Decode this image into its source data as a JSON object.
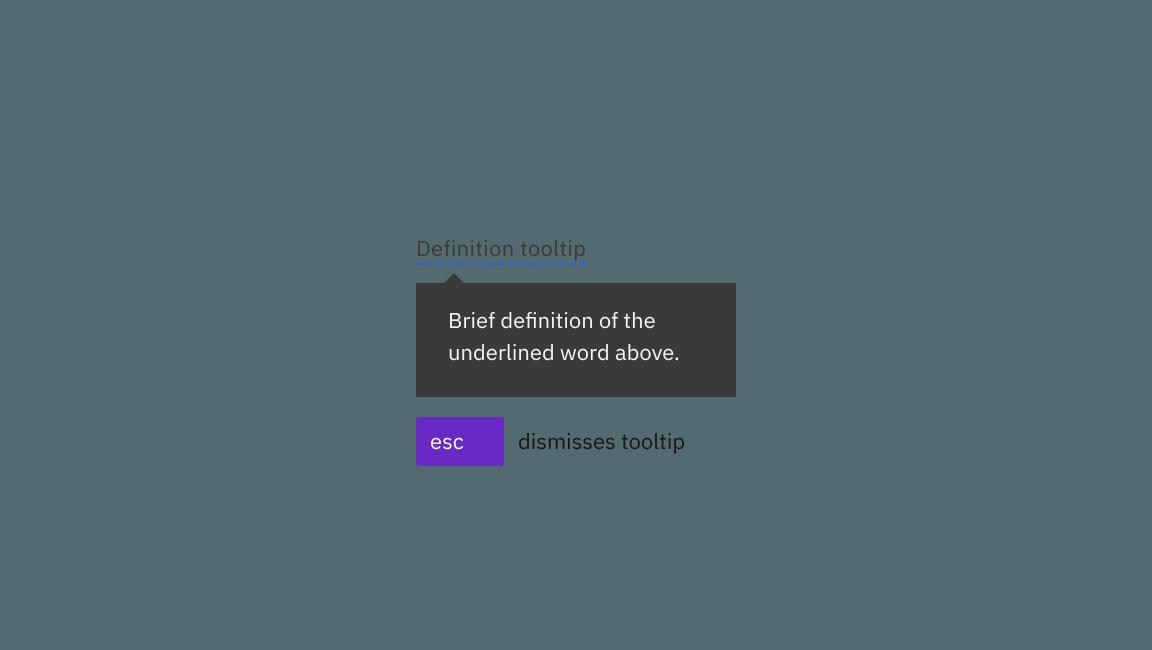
{
  "trigger_label": "Definition tooltip",
  "tooltip_body": "Brief definition of the underlined word above.",
  "key_label": "esc",
  "hint_text": "dismisses tooltip"
}
